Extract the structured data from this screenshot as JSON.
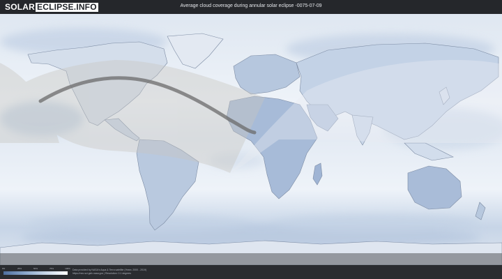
{
  "header": {
    "logo_solar": "SOLAR",
    "logo_rest": "ECLIPSE.INFO",
    "title": "Average cloud coverage during annular solar eclipse -0075-07-09"
  },
  "map": {
    "colors": {
      "ocean_clear": "#eef2f8",
      "cloud_light": "#c9d7e8",
      "cloud_mid": "#9fb6d4",
      "cloud_dense": "#6c89b4",
      "land_outline": "#7c8ba3",
      "eclipse_track": "#6b6b6b",
      "visibility_zone": "#c8c6c0"
    }
  },
  "legend": {
    "ticks": [
      "0%",
      "25%",
      "50%",
      "75%",
      "100%"
    ],
    "gradient": [
      "#4f6f9f",
      "#8aa6c9",
      "#c9d7e8",
      "#ffffff"
    ]
  },
  "footer": {
    "credit_line1": "Data provided by NASA's Aqua & Terra satellite (Years: 2000 - 2019)",
    "credit_line2": "https://neo.sci.gsfc.nasa.gov | Resolution: 0.1 degrees"
  }
}
